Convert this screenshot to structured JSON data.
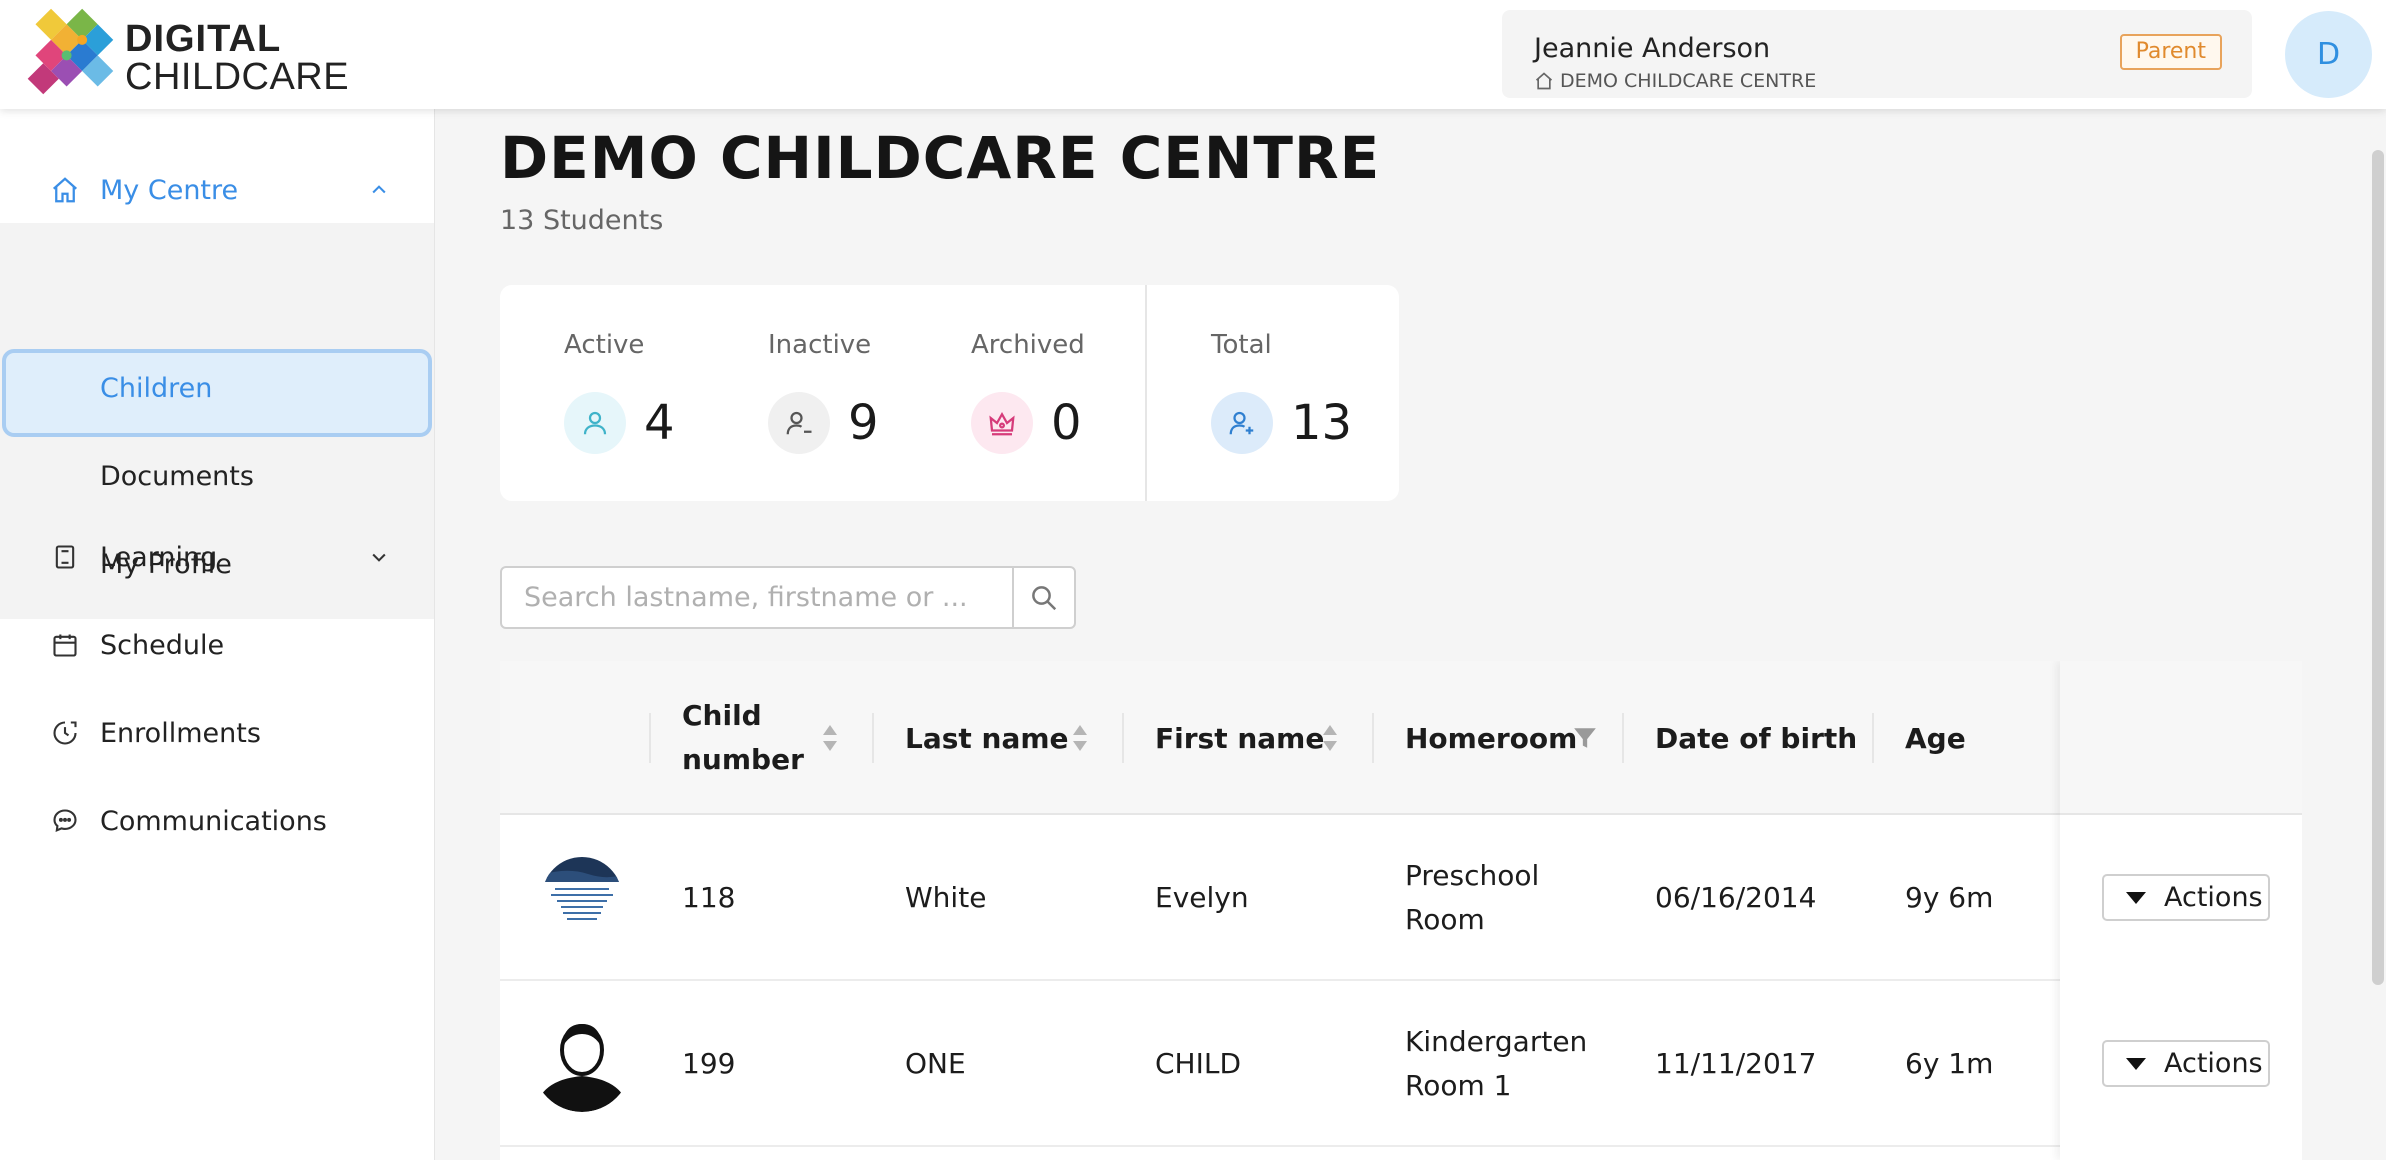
{
  "brand": {
    "line1": "DIGITAL",
    "line2": "CHILDCARE"
  },
  "user": {
    "name": "Jeannie Anderson",
    "centre": "DEMO CHILDCARE CENTRE",
    "role": "Parent",
    "avatar_initial": "D"
  },
  "sidebar": {
    "my_centre": {
      "label": "My Centre",
      "icon": "home-icon",
      "expanded": true
    },
    "sub_items": [
      "Children",
      "Documents",
      "My Profile"
    ],
    "selected": "Children",
    "items": [
      {
        "label": "Learning",
        "icon": "book-icon",
        "has_chevron": true
      },
      {
        "label": "Schedule",
        "icon": "calendar-icon"
      },
      {
        "label": "Enrollments",
        "icon": "enrollment-clock-icon"
      },
      {
        "label": "Communications",
        "icon": "chat-bubbles-icon"
      }
    ]
  },
  "page": {
    "title": "DEMO CHILDCARE CENTRE",
    "subtitle": "13 Students"
  },
  "stats": [
    {
      "label": "Active",
      "value": "4",
      "icon": "user-icon",
      "color": "#e6f6fa",
      "icon_color": "#3fb3c9"
    },
    {
      "label": "Inactive",
      "value": "9",
      "icon": "user-minus-icon",
      "color": "#f0f0f0",
      "icon_color": "#555555"
    },
    {
      "label": "Archived",
      "value": "0",
      "icon": "crown-icon",
      "color": "#fde8f0",
      "icon_color": "#d63b7a"
    },
    {
      "label": "Total",
      "value": "13",
      "icon": "user-plus-icon",
      "color": "#dcebfa",
      "icon_color": "#2f7fd0"
    }
  ],
  "search": {
    "placeholder": "Search lastname, firstname or ...",
    "value": ""
  },
  "table": {
    "columns": [
      "Child number",
      "Last name",
      "First name",
      "Homeroom",
      "Date of birth",
      "Age"
    ],
    "column_lines": [
      [
        "Child",
        "number"
      ],
      [
        "Last name"
      ],
      [
        "First name"
      ],
      [
        "Homeroom"
      ],
      [
        "Date of birth"
      ],
      [
        "Age"
      ]
    ],
    "rows": [
      {
        "photo": "logo-photo",
        "child_number": "118",
        "last_name": "White",
        "first_name": "Evelyn",
        "homeroom": [
          "Preschool",
          "Room"
        ],
        "dob": "06/16/2014",
        "age": "9y 6m",
        "action": "Actions"
      },
      {
        "photo": "default-avatar",
        "child_number": "199",
        "last_name": "ONE",
        "first_name": "CHILD",
        "homeroom": [
          "Kindergarten",
          "Room 1"
        ],
        "dob": "11/11/2017",
        "age": "6y 1m",
        "action": "Actions"
      }
    ]
  }
}
